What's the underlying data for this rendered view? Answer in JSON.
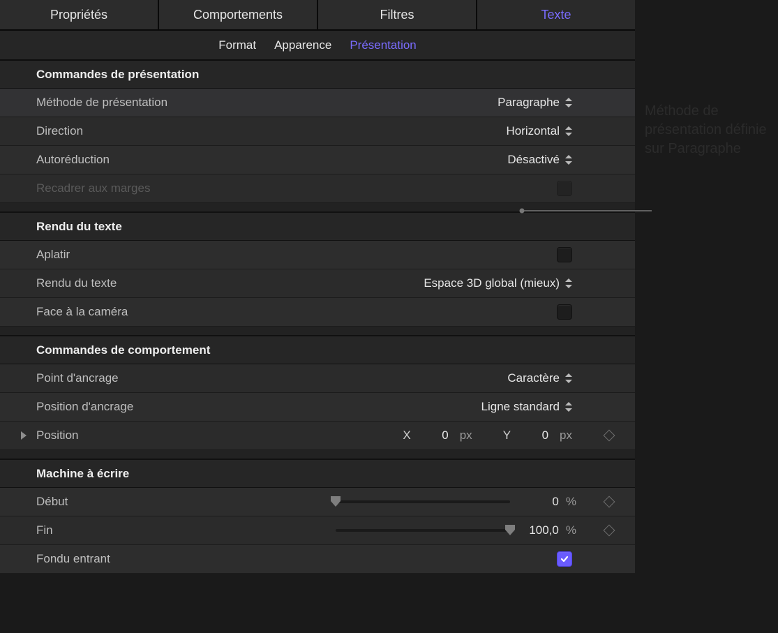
{
  "tabs": {
    "main": [
      "Propriétés",
      "Comportements",
      "Filtres",
      "Texte"
    ],
    "sub": [
      "Format",
      "Apparence",
      "Présentation"
    ]
  },
  "sections": {
    "presentation": {
      "title": "Commandes de présentation",
      "method": {
        "label": "Méthode de présentation",
        "value": "Paragraphe"
      },
      "direction": {
        "label": "Direction",
        "value": "Horizontal"
      },
      "autoreduce": {
        "label": "Autoréduction",
        "value": "Désactivé"
      },
      "recadrer": {
        "label": "Recadrer aux marges"
      }
    },
    "render": {
      "title": "Rendu du texte",
      "flatten": {
        "label": "Aplatir"
      },
      "textrender": {
        "label": "Rendu du texte",
        "value": "Espace 3D global (mieux)"
      },
      "facecamera": {
        "label": "Face à la caméra"
      }
    },
    "behavior": {
      "title": "Commandes de comportement",
      "anchorpoint": {
        "label": "Point d'ancrage",
        "value": "Caractère"
      },
      "anchorposition": {
        "label": "Position d'ancrage",
        "value": "Ligne standard"
      },
      "position": {
        "label": "Position",
        "x_label": "X",
        "x_value": "0",
        "x_unit": "px",
        "y_label": "Y",
        "y_value": "0",
        "y_unit": "px"
      }
    },
    "typewriter": {
      "title": "Machine à écrire",
      "start": {
        "label": "Début",
        "value": "0",
        "unit": "%",
        "slider_pct": 0
      },
      "end": {
        "label": "Fin",
        "value": "100,0",
        "unit": "%",
        "slider_pct": 100
      },
      "fadein": {
        "label": "Fondu entrant",
        "checked": true
      }
    }
  },
  "annotation": "Méthode de présentation définie sur Paragraphe"
}
